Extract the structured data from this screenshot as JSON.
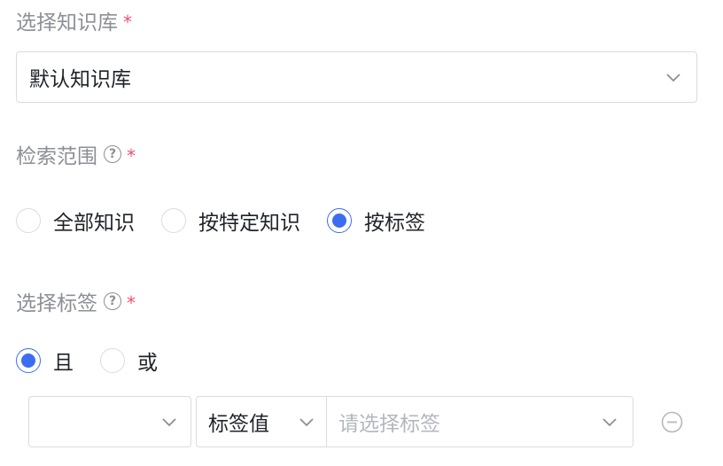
{
  "kb": {
    "label": "选择知识库",
    "required_mark": "*",
    "selected": "默认知识库",
    "chevron_icon": "chevron-down-icon"
  },
  "scope": {
    "label": "检索范围",
    "help_glyph": "?",
    "required_mark": "*",
    "options": [
      "全部知识",
      "按特定知识",
      "按标签"
    ],
    "selected_index": 2
  },
  "tags": {
    "label": "选择标签",
    "help_glyph": "?",
    "required_mark": "*",
    "logic_options": [
      "且",
      "或"
    ],
    "logic_selected_index": 0,
    "condition": {
      "field_value": "",
      "type_value": "标签值",
      "tag_placeholder": "请选择标签",
      "remove_icon": "minus-circle-icon"
    }
  },
  "colors": {
    "accent": "#3c6df0",
    "required": "#f0506e",
    "label": "#8c8f96",
    "border": "#d9dbe0"
  }
}
